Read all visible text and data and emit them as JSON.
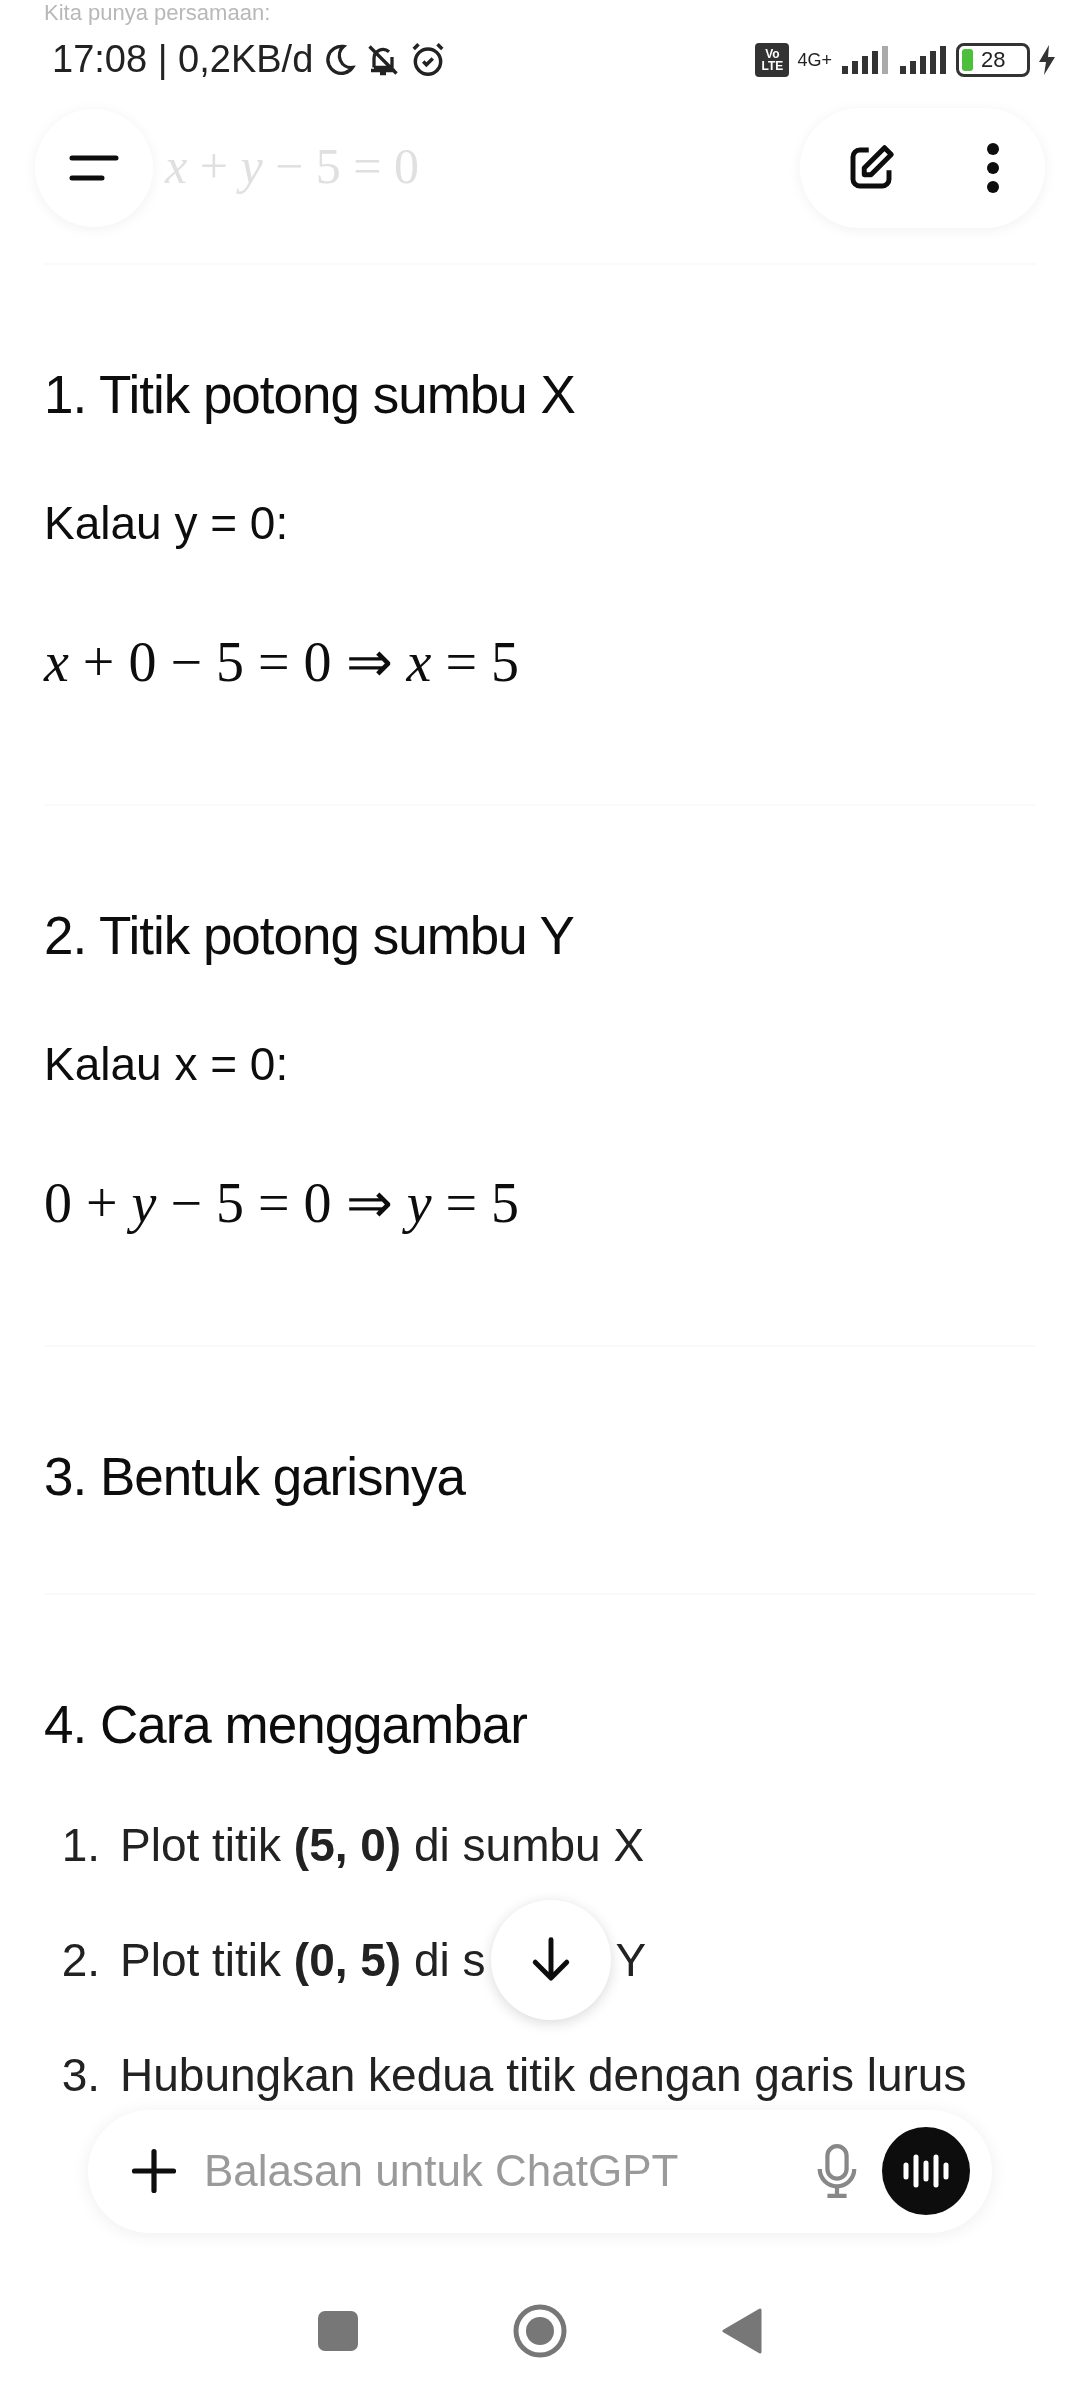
{
  "status_bar": {
    "time": "17:08 | 0,2KB/d",
    "volte": [
      "Vo",
      "LTE"
    ],
    "network": "4G+",
    "battery": "28"
  },
  "faded_intro": {
    "text": "Kita punya persamaan:",
    "formula": "*x* + *y* − 5 = 0"
  },
  "sections": [
    {
      "heading": "1. Titik potong sumbu X",
      "condition": "Kalau y = 0:",
      "formula": "*x* + 0 − 5 = 0 ⇒ *x* = 5"
    },
    {
      "heading": "2. Titik potong sumbu Y",
      "condition": "Kalau x = 0:",
      "formula": "0 + *y* − 5 = 0 ⇒ *y* = 5"
    },
    {
      "heading": "3. Bentuk garisnya"
    },
    {
      "heading": "4. Cara menggambar",
      "steps": [
        {
          "number": "1.",
          "text": "Plot titik **(5, 0)** di sumbu X"
        },
        {
          "number": "2.",
          "text": "Plot titik **(0, 5)** di s",
          "text_after": "Y"
        },
        {
          "number": "3.",
          "text": "Hubungkan kedua titik dengan garis lurus"
        }
      ]
    }
  ],
  "composer": {
    "placeholder": "Balasan untuk ChatGPT"
  }
}
